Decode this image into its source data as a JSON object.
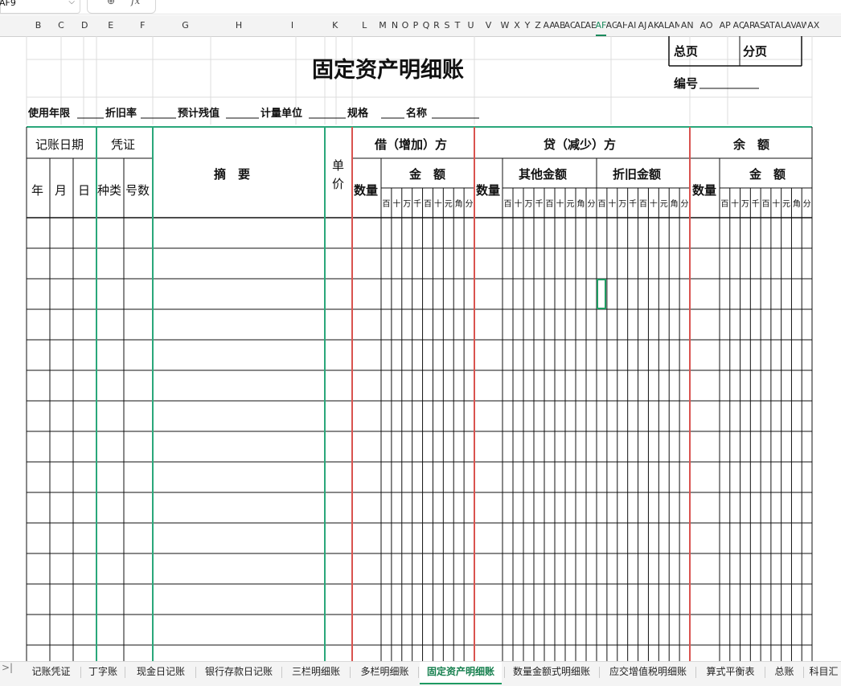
{
  "formula_bar": {
    "cell_ref": "AF9",
    "zoom_icon": "zoom-icon",
    "fx_label": "fx"
  },
  "columns": [
    "B",
    "C",
    "D",
    "E",
    "F",
    "G",
    "H",
    "I",
    "K",
    "L",
    "M",
    "N",
    "O",
    "P",
    "Q",
    "R",
    "S",
    "T",
    "U",
    "V",
    "W",
    "X",
    "Y",
    "Z",
    "AA",
    "AB",
    "AC",
    "AD",
    "AE",
    "AF",
    "AG",
    "AH",
    "AI",
    "AJ",
    "AK",
    "AL",
    "AM",
    "AN",
    "AO",
    "AP",
    "AQ",
    "AR",
    "AS",
    "AT",
    "AU",
    "AV",
    "AW",
    "AX"
  ],
  "selected_column": "AF",
  "ledger": {
    "title": "固定资产明细账",
    "total_page": "总页",
    "sub_page": "分页",
    "serial_no": "编号",
    "info": [
      "使用年限",
      "折旧率",
      "预计残值",
      "计量单位",
      "规格",
      "名称"
    ],
    "headers": {
      "date": "记账日期",
      "voucher": "凭证",
      "year": "年",
      "month": "月",
      "day": "日",
      "kind": "种类",
      "number": "号数",
      "summary": "摘　要",
      "unit_price_1": "单",
      "unit_price_2": "价",
      "debit": "借（增加）方",
      "credit": "贷（减少）方",
      "balance": "余　额",
      "quantity": "数量",
      "amount": "金　额",
      "other_amount": "其他金额",
      "depreciation_amount": "折旧金额",
      "digits_10": [
        "百",
        "十",
        "万",
        "千",
        "百",
        "十",
        "元",
        "角",
        "分"
      ],
      "digits_9": [
        "百",
        "十",
        "万",
        "千",
        "百",
        "十",
        "元",
        "角",
        "分"
      ]
    }
  },
  "sheet_tabs": [
    "记账凭证",
    "丁字账",
    "现金日记账",
    "银行存款日记账",
    "三栏明细账",
    "多栏明细账",
    "固定资产明细账",
    "数量金额式明细账",
    "应交增值税明细账",
    "算式平衡表",
    "总账",
    "科目汇"
  ],
  "active_tab": "固定资产明细账",
  "tab_nav_icon": "tab-nav-icon",
  "colors": {
    "accent": "#1a8a5c",
    "green_line": "#2aa77a",
    "red_line": "#d9534f",
    "grid": "#111111"
  }
}
